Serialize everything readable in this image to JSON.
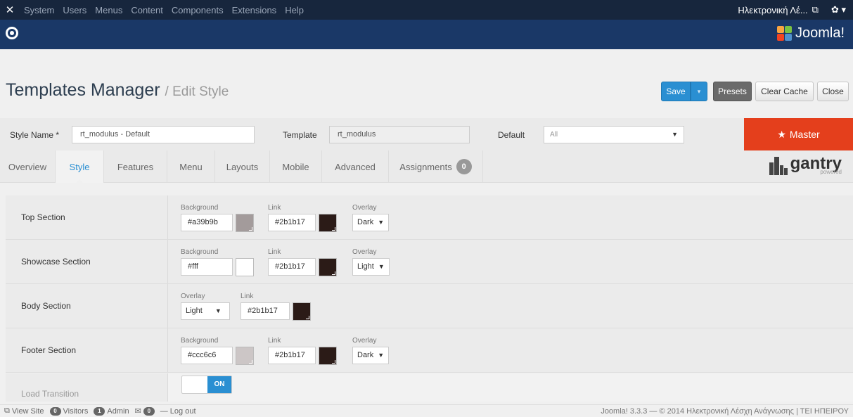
{
  "navbar": {
    "menu": [
      "System",
      "Users",
      "Menus",
      "Content",
      "Components",
      "Extensions",
      "Help"
    ],
    "site_name": "Ηλεκτρονική Λέ...",
    "external_icon": "external-link-icon",
    "gear_icon": "gear-icon"
  },
  "header": {
    "brand": "Joomla!"
  },
  "page": {
    "title": "Templates Manager",
    "subtitle": "/ Edit Style"
  },
  "toolbar": {
    "save": "Save",
    "save_dropdown": "▾",
    "presets": "Presets",
    "clear_cache": "Clear Cache",
    "close": "Close"
  },
  "form": {
    "style_name_label": "Style Name *",
    "style_name_value": "rt_modulus - Default",
    "template_label": "Template",
    "template_value": "rt_modulus",
    "default_label": "Default",
    "default_value": "All",
    "master_label": "Master"
  },
  "tabs": [
    {
      "label": "Overview"
    },
    {
      "label": "Style"
    },
    {
      "label": "Features"
    },
    {
      "label": "Menu"
    },
    {
      "label": "Layouts"
    },
    {
      "label": "Mobile"
    },
    {
      "label": "Advanced"
    },
    {
      "label": "Assignments",
      "badge": "0"
    }
  ],
  "gantry": {
    "word": "gantry",
    "powered": "powered"
  },
  "sections": [
    {
      "label": "Top Section",
      "background_label": "Background",
      "background": "#a39b9b",
      "background_color": "#a39b9b",
      "link_label": "Link",
      "link": "#2b1b17",
      "link_color": "#2b1b17",
      "overlay_label": "Overlay",
      "overlay": "Dark"
    },
    {
      "label": "Showcase Section",
      "background_label": "Background",
      "background": "#fff",
      "background_color": "#ffffff",
      "link_label": "Link",
      "link": "#2b1b17",
      "link_color": "#2b1b17",
      "overlay_label": "Overlay",
      "overlay": "Light"
    },
    {
      "label": "Body Section",
      "overlay_label": "Overlay",
      "overlay": "Light",
      "link_label": "Link",
      "link": "#2b1b17",
      "link_color": "#2b1b17"
    },
    {
      "label": "Footer Section",
      "background_label": "Background",
      "background": "#ccc6c6",
      "background_color": "#ccc6c6",
      "link_label": "Link",
      "link": "#2b1b17",
      "link_color": "#2b1b17",
      "overlay_label": "Overlay",
      "overlay": "Dark"
    }
  ],
  "load_transition": {
    "label": "Load Transition",
    "state": "ON"
  },
  "status": {
    "view_site": "View Site",
    "visitors_count": "0",
    "visitors": "Visitors",
    "admin_count": "1",
    "admin": "Admin",
    "messages_count": "0",
    "logout": "Log out",
    "copyright": "Joomla! 3.3.3 — © 2014 Ηλεκτρονική Λέσχη Ανάγνωσης | ΤΕΙ ΗΠΕΙΡΟΥ"
  },
  "colors": {
    "accent": "#2a8fd2",
    "master": "#e43f1c",
    "navbar": "#17263d",
    "header": "#1a3867"
  }
}
